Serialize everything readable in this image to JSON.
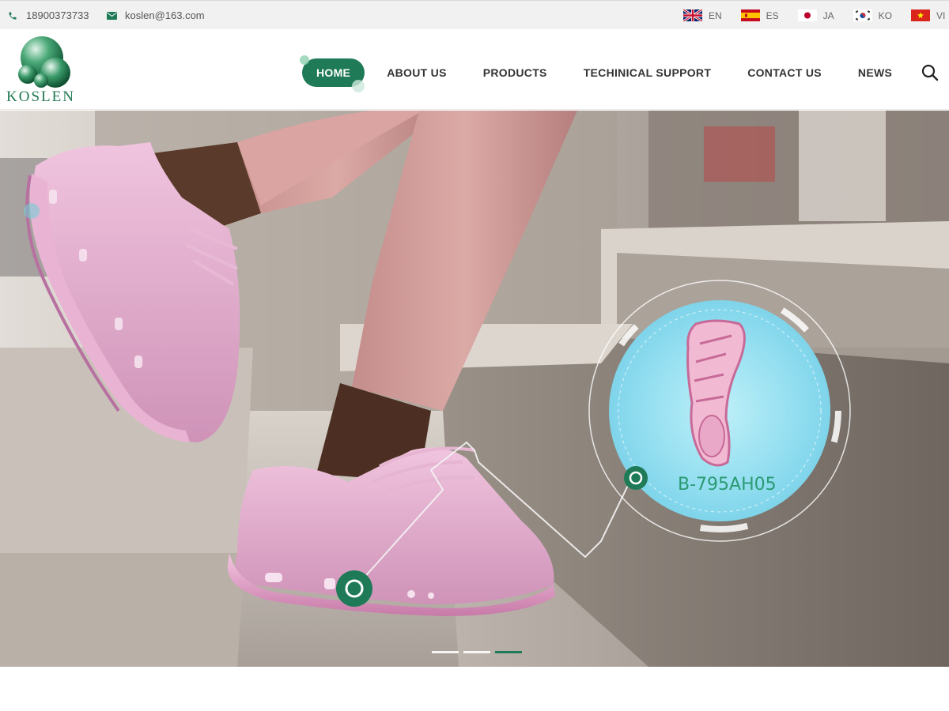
{
  "topbar": {
    "phone": "18900373733",
    "email": "koslen@163.com",
    "languages": [
      {
        "code": "EN",
        "flag": "uk-flag-icon"
      },
      {
        "code": "ES",
        "flag": "spain-flag-icon"
      },
      {
        "code": "JA",
        "flag": "japan-flag-icon"
      },
      {
        "code": "KO",
        "flag": "korea-flag-icon"
      },
      {
        "code": "VI",
        "flag": "vietnam-flag-icon"
      }
    ]
  },
  "header": {
    "brand": "KOSLEN",
    "nav": [
      "HOME",
      "ABOUT US",
      "PRODUCTS",
      "TECHINICAL SUPPORT",
      "CONTACT US",
      "NEWS"
    ],
    "active": "HOME"
  },
  "hero": {
    "product_code": "B-795AH05",
    "slides": 3,
    "current_slide": 3
  },
  "colors": {
    "brand": "#1e7a57",
    "accent": "#2b9a72",
    "product_circle": "#8fdceb"
  }
}
